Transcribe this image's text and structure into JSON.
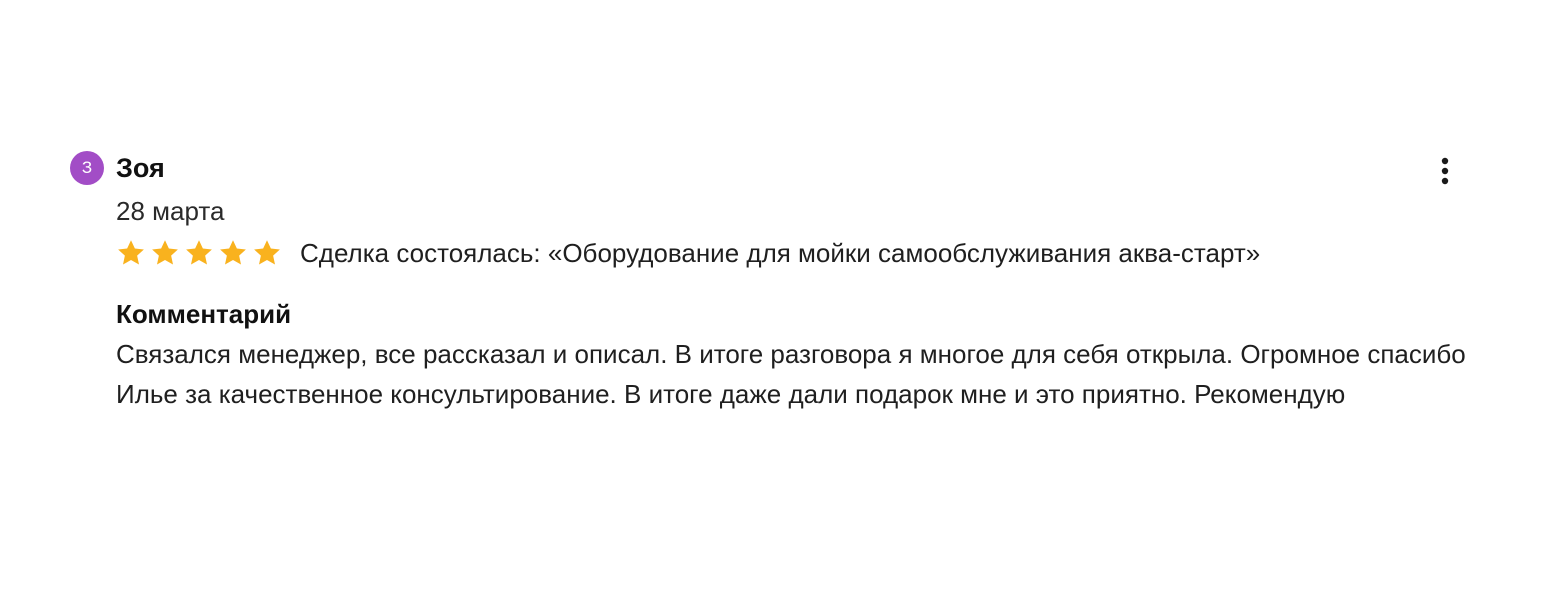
{
  "review": {
    "avatar_letter": "З",
    "author": "Зоя",
    "date": "28 марта",
    "rating": 5,
    "rating_max": 5,
    "star_color": "#f9b21e",
    "deal_text": "Сделка состоялась: «Оборудование для мойки самообслуживания аква-старт»",
    "comment_label": "Комментарий",
    "comment_text": "Связался менеджер, все рассказал и описал. В итоге разговора я многое для себя открыла. Огромное спасибо Илье за качественное консультирование. В итоге даже дали подарок мне и это приятно. Рекомендую",
    "more_icon": "more-vertical-icon"
  },
  "colors": {
    "avatar_bg": "#a24dc6"
  }
}
